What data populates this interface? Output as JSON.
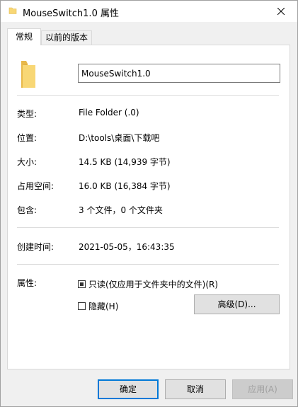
{
  "window": {
    "title": "MouseSwitch1.0 属性"
  },
  "tabs": [
    {
      "label": "常规",
      "active": true
    },
    {
      "label": "以前的版本",
      "active": false
    }
  ],
  "general": {
    "name_value": "MouseSwitch1.0",
    "rows": [
      {
        "label": "类型:",
        "value": "File Folder (.0)"
      },
      {
        "label": "位置:",
        "value": "D:\\tools\\桌面\\下载吧"
      },
      {
        "label": "大小:",
        "value": "14.5 KB (14,939 字节)"
      },
      {
        "label": "占用空间:",
        "value": "16.0 KB (16,384 字节)"
      },
      {
        "label": "包含:",
        "value": "3 个文件，0 个文件夹"
      }
    ],
    "created": {
      "label": "创建时间:",
      "value": "2021-05-05，16:43:35"
    },
    "attributes": {
      "label": "属性:",
      "readonly_label": "只读(仅应用于文件夹中的文件)(R)",
      "readonly_state": "indeterminate",
      "hidden_label": "隐藏(H)",
      "hidden_checked": false,
      "advanced_label": "高级(D)..."
    }
  },
  "buttons": {
    "ok": "确定",
    "cancel": "取消",
    "apply": "应用(A)"
  },
  "icons": {
    "title": "folder-icon",
    "close": "close-icon",
    "main": "folder-icon"
  },
  "colors": {
    "folder": "#f8d775",
    "accent": "#0078d7"
  }
}
